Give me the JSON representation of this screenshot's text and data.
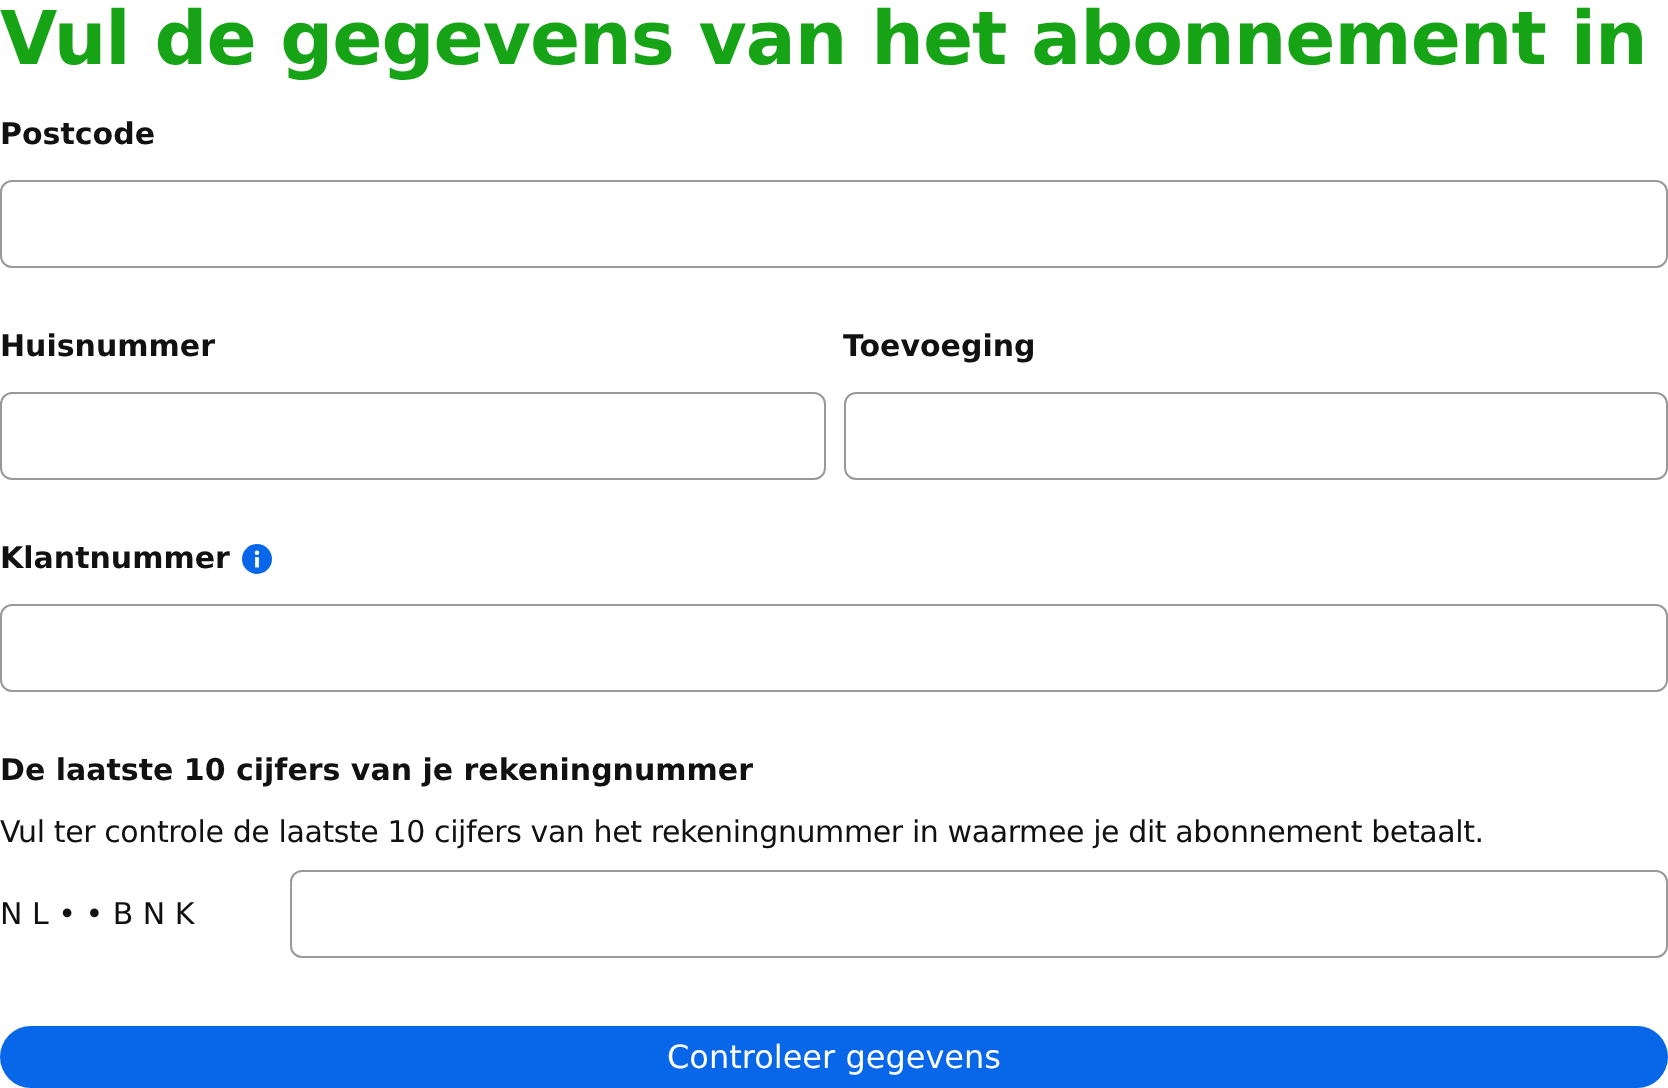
{
  "heading": "Vul de gegevens van het abonnement in",
  "fields": [
    {
      "label": "Postcode",
      "kind": "full"
    },
    {
      "label": "Huisnummer",
      "kind": "half"
    },
    {
      "label": "Toevoeging",
      "kind": "half"
    },
    {
      "label": "Klantnummer",
      "kind": "full",
      "info": true
    }
  ],
  "account": {
    "title": "De laatste 10 cijfers van je rekeningnummer",
    "description": "Vul ter controle de laatste 10 cijfers van het rekeningnummer in waarmee je dit abonnement betaalt.",
    "prefix": "N L • • B N K"
  },
  "button": "Controleer gegevens"
}
